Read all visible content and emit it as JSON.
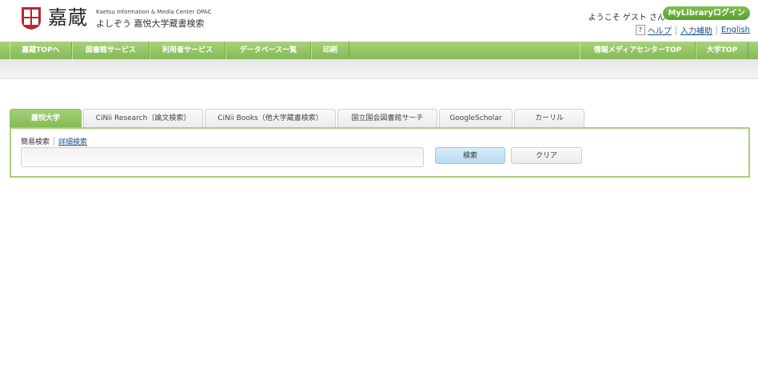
{
  "header": {
    "logo_main": "嘉蔵",
    "logo_en": "Kaetsu Information & Media Center OPAC",
    "logo_jp": "よしぞう 嘉悦大学蔵書検索",
    "welcome": "ようこそ ゲスト さん",
    "mylibrary_label": "MyLibraryログイン",
    "links": {
      "help_icon": "?",
      "help": "ヘルプ",
      "input_assist": "入力補助",
      "english": "English"
    }
  },
  "nav": {
    "items": [
      "嘉蔵TOPへ",
      "図書館サービス",
      "利用者サービス",
      "データベース一覧",
      "印刷"
    ],
    "right_items": [
      "情報メディアセンターTOP",
      "大学TOP"
    ]
  },
  "tabs": [
    "嘉悦大学",
    "CiNii Research（論文検索）",
    "CiNii Books（他大学蔵書検索）",
    "国立国会図書館サーチ",
    "GoogleScholar",
    "カーリル"
  ],
  "active_tab_index": 0,
  "search": {
    "mode_simple": "簡易検索",
    "mode_advanced": "詳細検索",
    "input_value": "",
    "search_button": "検索",
    "clear_button": "クリア"
  },
  "colors": {
    "accent_green": "#8cc060",
    "link_blue": "#1a4f8a",
    "logo_red": "#b8262f"
  }
}
